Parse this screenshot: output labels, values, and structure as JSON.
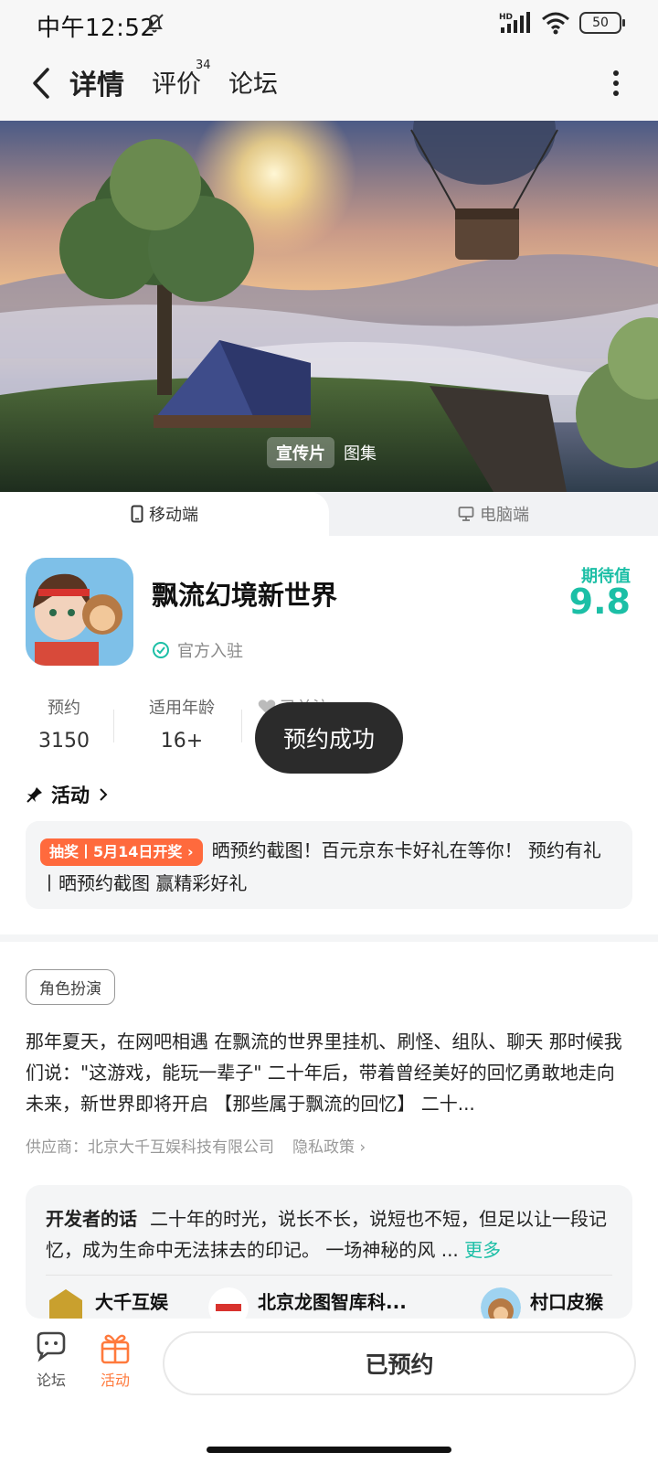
{
  "status_bar": {
    "time": "中午12:52",
    "battery": "50",
    "network": "HD"
  },
  "nav": {
    "tabs": [
      {
        "label": "详情",
        "active": true
      },
      {
        "label": "评价",
        "badge": "34"
      },
      {
        "label": "论坛"
      }
    ]
  },
  "hero": {
    "media_tabs": [
      "宣传片",
      "图集"
    ],
    "active_media": "宣传片"
  },
  "platform": {
    "mobile": "移动端",
    "pc": "电脑端"
  },
  "app": {
    "title": "飘流幻境新世界",
    "official": "官方入驻",
    "expect_label": "期待值",
    "expect_value": "9.8"
  },
  "stats": [
    {
      "label": "预约",
      "value": "3150"
    },
    {
      "label": "适用年龄",
      "value": "16+"
    }
  ],
  "followed": "已关注",
  "toast": "预约成功",
  "activity": {
    "header": "活动",
    "tag": "抽奖丨5月14日开奖",
    "text": "晒预约截图！百元京东卡好礼在等你！ 预约有礼丨晒预约截图 赢精彩好礼"
  },
  "genre": "角色扮演",
  "description": "那年夏天，在网吧相遇 在飘流的世界里挂机、刷怪、组队、聊天 那时候我们说：\"这游戏，能玩一辈子\" 二十年后，带着曾经美好的回忆勇敢地走向未来，新世界即将开启 【那些属于飘流的回忆】 二十...",
  "supplier": {
    "label": "供应商：北京大千互娱科技有限公司",
    "privacy": "隐私政策"
  },
  "developer": {
    "title": "开发者的话",
    "text": "二十年的时光，说长不长，说短也不短，但足以让一段记忆，成为生命中无法抹去的印记。 一场神秘的风 ...",
    "more": "更多",
    "items": [
      "大千互娱",
      "北京龙图智库科...",
      "村口皮猴"
    ]
  },
  "bottom": {
    "forum": "论坛",
    "activity": "活动",
    "reserved": "已预约"
  },
  "colors": {
    "accent": "#1cbfa6",
    "orange": "#ff6a3d",
    "toast_bg": "#2b2b2b"
  }
}
